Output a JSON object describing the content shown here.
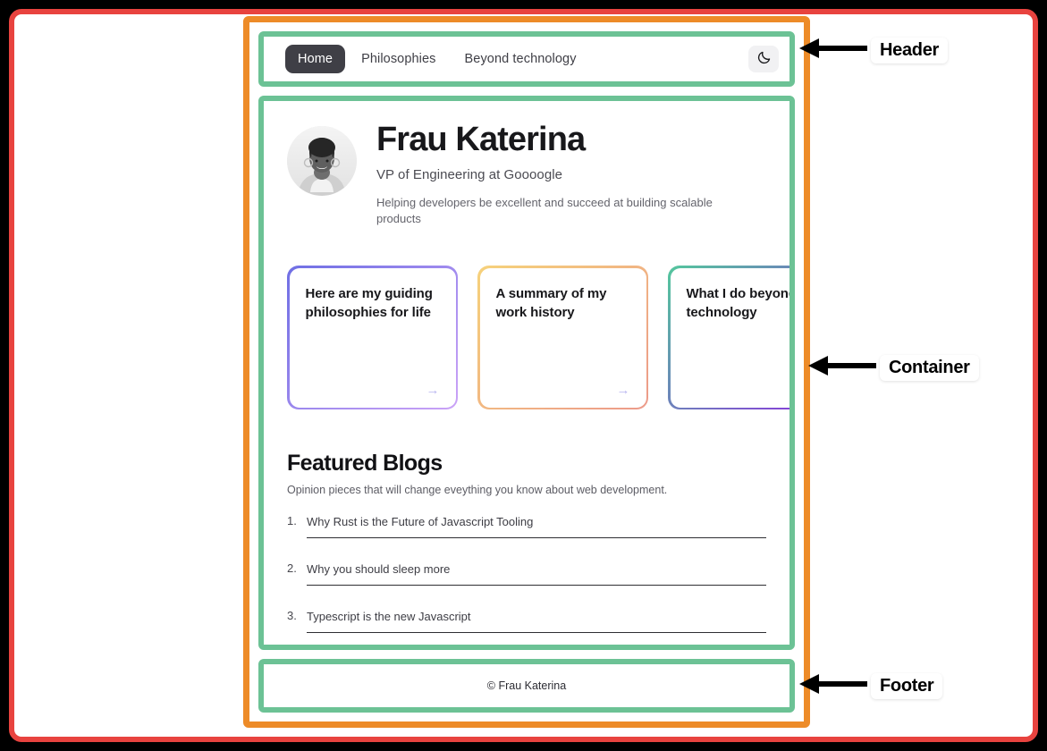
{
  "annotations": {
    "header_label": "Header",
    "container_label": "Container",
    "footer_label": "Footer",
    "colors": {
      "outer_frame": "#e8433f",
      "container_frame": "#ed8b28",
      "section_frame": "#6cc295"
    }
  },
  "header": {
    "nav_items": [
      {
        "label": "Home",
        "active": true
      },
      {
        "label": "Philosophies",
        "active": false
      },
      {
        "label": "Beyond technology",
        "active": false
      }
    ],
    "theme_toggle_icon": "moon-icon"
  },
  "profile": {
    "avatar_icon": "user-photo",
    "name": "Frau Katerina",
    "role": "VP of Engineering at Goooogle",
    "bio": "Helping developers be excellent and succeed at building scalable products"
  },
  "cards": [
    {
      "title": "Here are my guiding philosophies for life",
      "arrow_icon": "arrow-right-icon",
      "border_from": "#6f6fe4",
      "border_to": "#cba3f7"
    },
    {
      "title": "A summary of my work history",
      "arrow_icon": "arrow-right-icon",
      "border_from": "#f6d27b",
      "border_to": "#ec9a8a"
    },
    {
      "title": "What I do beyond technology",
      "arrow_icon": "arrow-right-icon",
      "border_from": "#54c79d",
      "border_to": "#8c2de0"
    }
  ],
  "featured": {
    "title": "Featured Blogs",
    "subtitle": "Opinion pieces that will change eveything you know about web development.",
    "items": [
      {
        "title": "Why Rust is the Future of Javascript Tooling"
      },
      {
        "title": "Why you should sleep more"
      },
      {
        "title": "Typescript is the new Javascript"
      }
    ]
  },
  "footer": {
    "copyright": "© Frau Katerina"
  }
}
